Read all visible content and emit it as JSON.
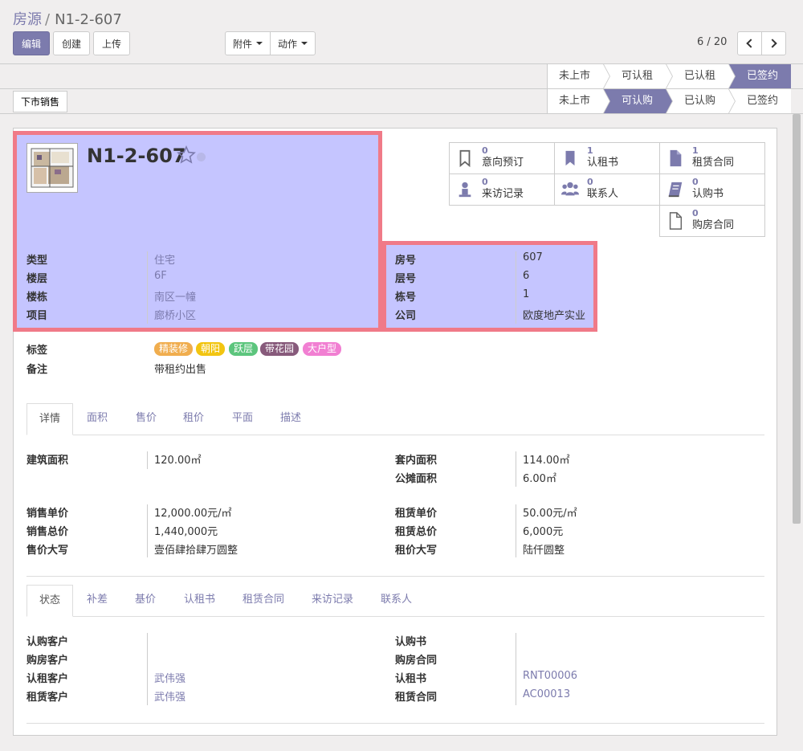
{
  "breadcrumb": {
    "parent": "房源",
    "sep": "/",
    "current": "N1-2-607"
  },
  "toolbar": {
    "edit": "编辑",
    "create": "创建",
    "upload": "上传",
    "attachment": "附件",
    "action": "动作"
  },
  "pager": {
    "value": "6 / 20"
  },
  "rent_stages": [
    "未上市",
    "可认租",
    "已认租",
    "已签约"
  ],
  "rent_active": 3,
  "sale_action": "下市销售",
  "sale_stages": [
    "未上市",
    "可认购",
    "已认购",
    "已签约"
  ],
  "sale_active": 1,
  "record": {
    "name": "N1-2-607"
  },
  "fields_left": [
    {
      "label": "类型",
      "value": "住宅"
    },
    {
      "label": "楼层",
      "value": "6F"
    },
    {
      "label": "楼栋",
      "value": "南区一幢"
    },
    {
      "label": "项目",
      "value": "廊桥小区"
    }
  ],
  "fields_right": [
    {
      "label": "房号",
      "value": "607"
    },
    {
      "label": "层号",
      "value": "6"
    },
    {
      "label": "栋号",
      "value": "1"
    },
    {
      "label": "公司",
      "value": "欧度地产实业"
    }
  ],
  "smart_buttons": [
    {
      "count": "0",
      "label": "意向预订",
      "icon": "bookmark-outline-icon"
    },
    {
      "count": "1",
      "label": "认租书",
      "icon": "bookmark-icon"
    },
    {
      "count": "1",
      "label": "租赁合同",
      "icon": "file-icon"
    },
    {
      "count": "0",
      "label": "来访记录",
      "icon": "user-icon"
    },
    {
      "count": "0",
      "label": "联系人",
      "icon": "users-icon"
    },
    {
      "count": "0",
      "label": "认购书",
      "icon": "book-icon"
    },
    {
      "count": "0",
      "label": "购房合同",
      "icon": "file-outline-icon"
    }
  ],
  "tags_label": "标签",
  "tags": [
    {
      "text": "精装修",
      "color": "#f0ad4e"
    },
    {
      "text": "朝阳",
      "color": "#f2c511"
    },
    {
      "text": "跃层",
      "color": "#5cc57d"
    },
    {
      "text": "带花园",
      "color": "#875a7b"
    },
    {
      "text": "大户型",
      "color": "#f17fd2"
    }
  ],
  "note": {
    "label": "备注",
    "value": "带租约出售"
  },
  "tabs1": [
    "详情",
    "面积",
    "售价",
    "租价",
    "平面",
    "描述"
  ],
  "details": {
    "build_area": {
      "label": "建筑面积",
      "value": "120.00㎡"
    },
    "inner_area": {
      "label": "套内面积",
      "value": "114.00㎡"
    },
    "shared_area": {
      "label": "公摊面积",
      "value": "6.00㎡"
    },
    "sale_unit": {
      "label": "销售单价",
      "value": "12,000.00元/㎡"
    },
    "sale_total": {
      "label": "销售总价",
      "value": "1,440,000元"
    },
    "sale_words": {
      "label": "售价大写",
      "value": "壹佰肆拾肆万圆整"
    },
    "rent_unit": {
      "label": "租赁单价",
      "value": "50.00元/㎡"
    },
    "rent_total": {
      "label": "租赁总价",
      "value": "6,000元"
    },
    "rent_words": {
      "label": "租价大写",
      "value": "陆仟圆整"
    }
  },
  "tabs2": [
    "状态",
    "补差",
    "基价",
    "认租书",
    "租赁合同",
    "来访记录",
    "联系人"
  ],
  "status_left": [
    {
      "label": "认购客户",
      "value": ""
    },
    {
      "label": "购房客户",
      "value": ""
    },
    {
      "label": "认租客户",
      "value": "武伟强"
    },
    {
      "label": "租赁客户",
      "value": "武伟强"
    }
  ],
  "status_right": [
    {
      "label": "认购书",
      "value": ""
    },
    {
      "label": "购房合同",
      "value": ""
    },
    {
      "label": "认租书",
      "value": "RNT00006"
    },
    {
      "label": "租赁合同",
      "value": "AC00013"
    }
  ]
}
